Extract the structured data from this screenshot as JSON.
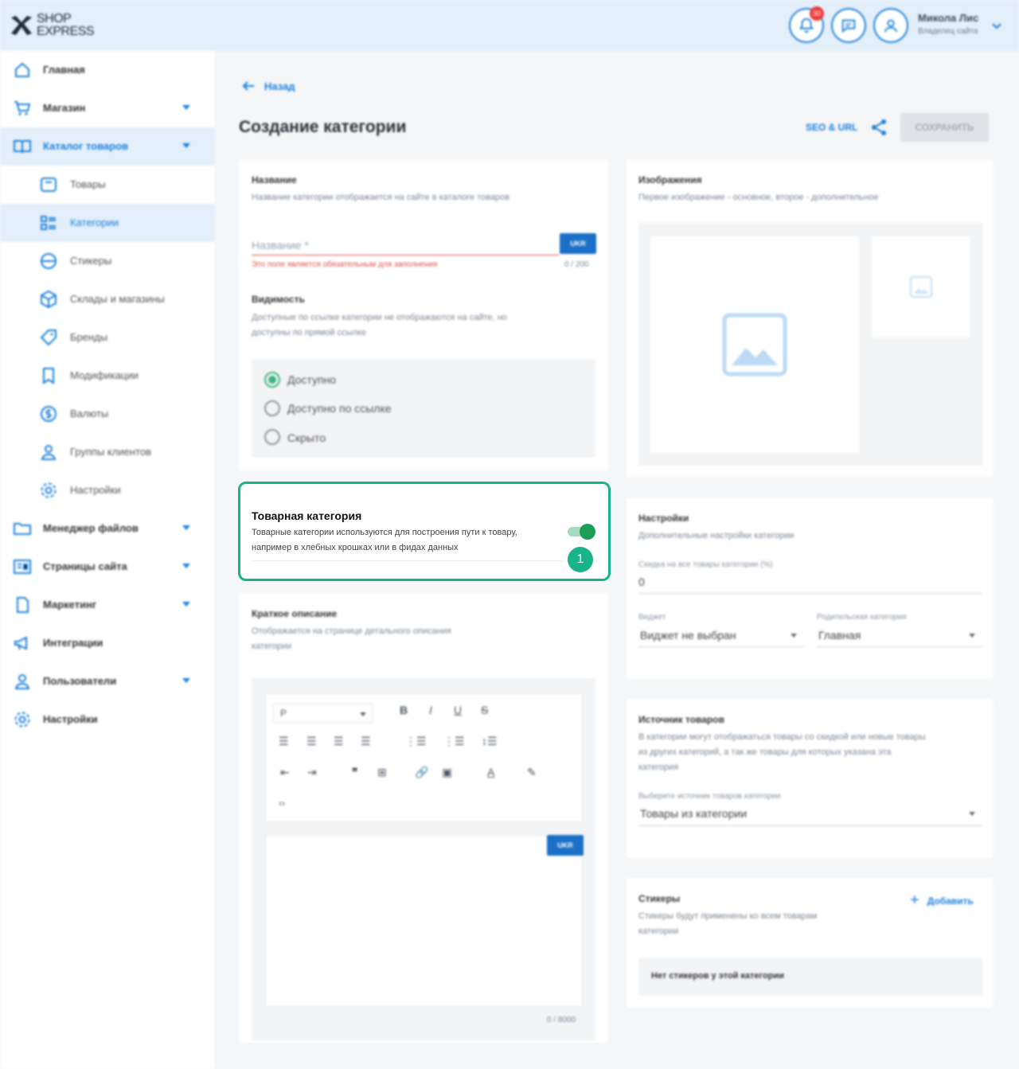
{
  "header": {
    "logo_line1": "SHOP",
    "logo_line2": "EXPRESS",
    "notifications_count": "30",
    "user_name": "Микола Лис",
    "user_role": "Владелец сайта"
  },
  "sidebar": {
    "items": [
      {
        "label": "Главная",
        "icon": "home-icon"
      },
      {
        "label": "Магазин",
        "icon": "cart-icon"
      },
      {
        "label": "Каталог товаров",
        "icon": "book-icon"
      },
      {
        "label": "Товары",
        "icon": "box-icon"
      },
      {
        "label": "Категории",
        "icon": "list-icon"
      },
      {
        "label": "Стикеры",
        "icon": "sticker-icon"
      },
      {
        "label": "Склады и магазины",
        "icon": "cube-icon"
      },
      {
        "label": "Бренды",
        "icon": "tag-icon"
      },
      {
        "label": "Модификации",
        "icon": "bookmark-icon"
      },
      {
        "label": "Валюты",
        "icon": "currency-icon"
      },
      {
        "label": "Группы клиентов",
        "icon": "users-icon"
      },
      {
        "label": "Настройки",
        "icon": "gear-icon"
      },
      {
        "label": "Менеджер файлов",
        "icon": "folder-icon"
      },
      {
        "label": "Страницы сайта",
        "icon": "pages-icon"
      },
      {
        "label": "Маркетинг",
        "icon": "document-icon"
      },
      {
        "label": "Интеграции",
        "icon": "megaphone-icon"
      },
      {
        "label": "Пользователи",
        "icon": "user-icon"
      },
      {
        "label": "Настройки",
        "icon": "gear-icon"
      }
    ]
  },
  "page": {
    "back_label": "Назад",
    "title": "Создание категории",
    "seo_label": "SEO & URL",
    "save_label": "СОХРАНИТЬ"
  },
  "name_card": {
    "title": "Название",
    "subtitle": "Название категории отображается на сайте в каталоге товаров",
    "placeholder": "Название *",
    "lang": "UKR",
    "error": "Это поле является обязательным для заполнения",
    "counter": "0 / 200"
  },
  "visibility": {
    "title": "Видимость",
    "subtitle_line1": "Доступные по ссылке категории не отображаются на сайте, но",
    "subtitle_line2": "доступны по прямой ссылке",
    "options": [
      "Доступно",
      "Доступно по ссылке",
      "Скрыто"
    ],
    "selected": "Доступно"
  },
  "product_category": {
    "title": "Товарная категория",
    "subtitle_line1": "Товарные категории используются для построения пути к товару,",
    "subtitle_line2": "например в хлебных крошках или в фидах данных",
    "enabled": true,
    "step": "1"
  },
  "short_desc": {
    "title": "Краткое описание",
    "subtitle_line1": "Отображается на странице детального описания",
    "subtitle_line2": "категории",
    "format": "P",
    "lang": "UKR",
    "counter": "0 / 8000"
  },
  "images": {
    "title": "Изображения",
    "subtitle": "Первое изображение - основное, второе - дополнительное"
  },
  "settings": {
    "title": "Настройки",
    "subtitle": "Дополнительные настройки категории",
    "discount_label": "Скидка на все товары категории (%)",
    "discount_value": "0",
    "widget_label": "Виджет",
    "widget_value": "Виджет не выбран",
    "parent_label": "Родительская категория",
    "parent_value": "Главная"
  },
  "source": {
    "title": "Источник товаров",
    "subtitle_line1": "В категории могут отображаться товары со скидкой или новые товары",
    "subtitle_line2": "из других категорий, а так же товары для которых указана эта",
    "subtitle_line3": "категория",
    "select_label": "Выберите источник товаров категории",
    "select_value": "Товары из категории"
  },
  "stickers": {
    "title": "Стикеры",
    "subtitle_line1": "Стикеры будут применены ко всем товарам",
    "subtitle_line2": "категории",
    "add_label": "Добавить",
    "empty": "Нет стикеров у этой категории"
  },
  "colors": {
    "accent": "#1a7fd9",
    "highlight": "#19b38a",
    "error": "#e44c4c",
    "toggle_on": "#1e9d59"
  }
}
